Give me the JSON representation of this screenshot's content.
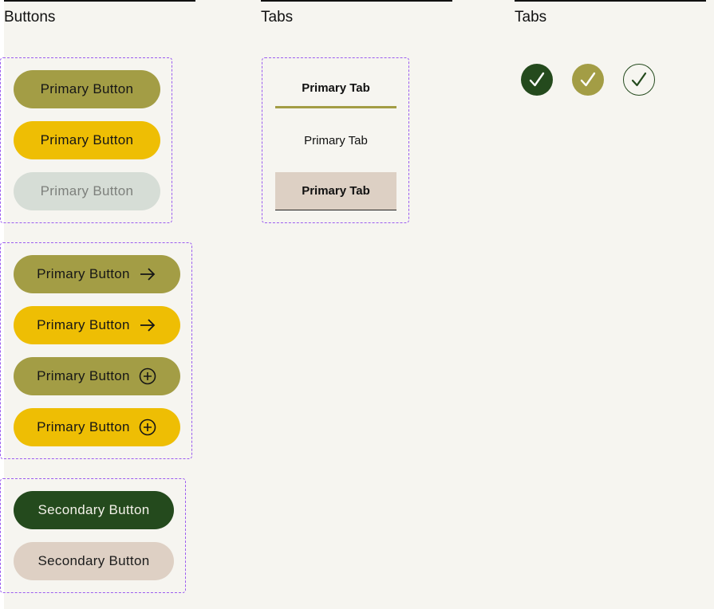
{
  "headings": {
    "buttons": "Buttons",
    "tabs": "Tabs",
    "checks": "Tabs"
  },
  "primary_group": [
    {
      "label": "Primary Button",
      "variant": "olive",
      "state": "default"
    },
    {
      "label": "Primary Button",
      "variant": "yellow",
      "state": "hover"
    },
    {
      "label": "Primary Button",
      "variant": "grey",
      "state": "disabled"
    }
  ],
  "icon_group": [
    {
      "label": "Primary Button",
      "variant": "olive",
      "icon": "arrow-right-icon"
    },
    {
      "label": "Primary Button",
      "variant": "yellow",
      "icon": "arrow-right-icon"
    },
    {
      "label": "Primary Button",
      "variant": "olive",
      "icon": "plus-circle-icon"
    },
    {
      "label": "Primary Button",
      "variant": "yellow",
      "icon": "plus-circle-icon"
    }
  ],
  "secondary_group": [
    {
      "label": "Secondary Button",
      "variant": "dark-green"
    },
    {
      "label": "Secondary Button",
      "variant": "beige"
    }
  ],
  "tabs": [
    {
      "label": "Primary Tab",
      "state": "active"
    },
    {
      "label": "Primary Tab",
      "state": "default"
    },
    {
      "label": "Primary Tab",
      "state": "selected"
    }
  ],
  "checkmarks": [
    {
      "icon": "check-icon",
      "style": "filled-dark-green"
    },
    {
      "icon": "check-icon",
      "style": "filled-olive"
    },
    {
      "icon": "check-icon",
      "style": "outline"
    }
  ],
  "colors": {
    "olive": "#a39d45",
    "yellow": "#eebe04",
    "disabled": "#d6ddd6",
    "dark_green": "#244a1d",
    "beige": "#ded0c4",
    "group_outline": "#9b5cf0",
    "background": "#f6f5f0"
  }
}
